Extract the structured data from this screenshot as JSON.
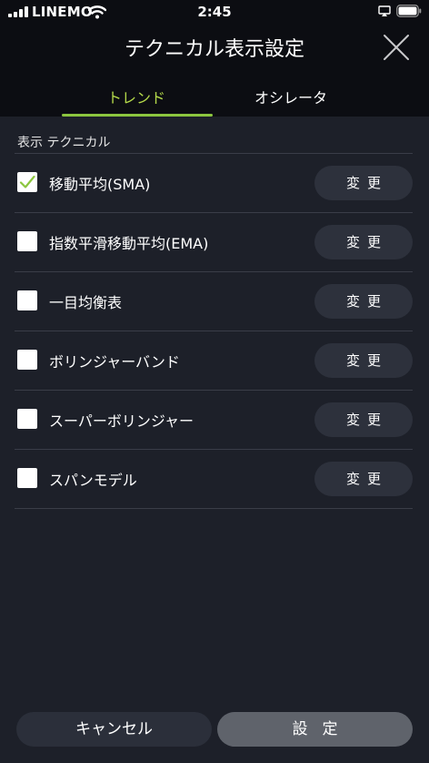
{
  "status_bar": {
    "carrier": "LINEMO",
    "time": "2:45"
  },
  "header": {
    "title": "テクニカル表示設定"
  },
  "tabs": [
    {
      "label": "トレンド",
      "active": true
    },
    {
      "label": "オシレータ",
      "active": false
    }
  ],
  "list": {
    "header": "表示 テクニカル",
    "items": [
      {
        "label": "移動平均(SMA)",
        "checked": true,
        "button": "変更"
      },
      {
        "label": "指数平滑移動平均(EMA)",
        "checked": false,
        "button": "変更"
      },
      {
        "label": "一目均衡表",
        "checked": false,
        "button": "変更"
      },
      {
        "label": "ボリンジャーバンド",
        "checked": false,
        "button": "変更"
      },
      {
        "label": "スーパーボリンジャー",
        "checked": false,
        "button": "変更"
      },
      {
        "label": "スパンモデル",
        "checked": false,
        "button": "変更"
      }
    ]
  },
  "footer": {
    "cancel_label": "キャンセル",
    "set_label": "設定"
  },
  "colors": {
    "accent": "#8cc63f",
    "active_tab_text": "#b4d94a",
    "background": "#1d2029",
    "header_background": "#0c0d12"
  }
}
